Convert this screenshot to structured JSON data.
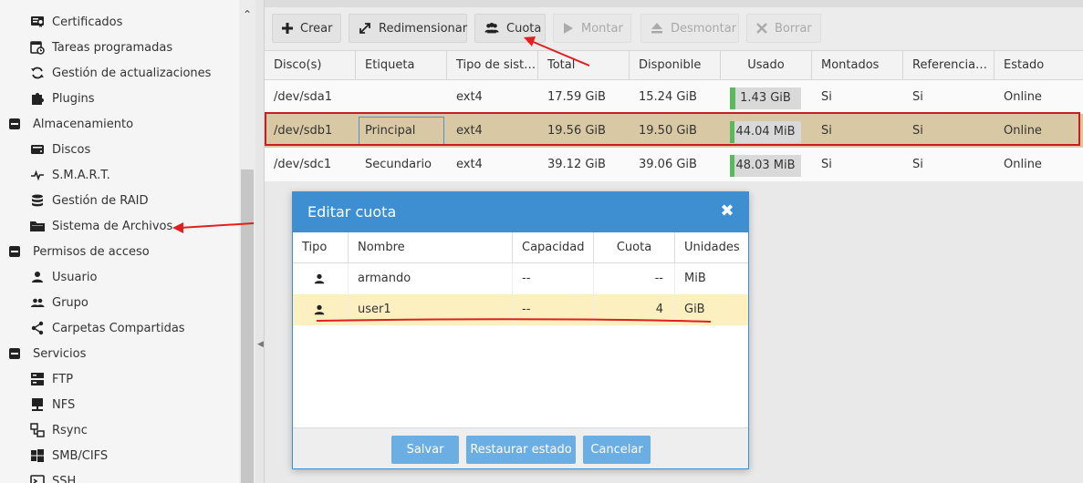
{
  "sidebar": {
    "items": [
      {
        "label": "Certificados",
        "icon": "certificate-icon",
        "level": 1
      },
      {
        "label": "Tareas programadas",
        "icon": "calendar-clock-icon",
        "level": 1
      },
      {
        "label": "Gestión de actualizaciones",
        "icon": "refresh-icon",
        "level": 1
      },
      {
        "label": "Plugins",
        "icon": "puzzle-icon",
        "level": 1
      },
      {
        "label": "Almacenamiento",
        "icon": "collapse-icon",
        "level": 0
      },
      {
        "label": "Discos",
        "icon": "disk-icon",
        "level": 1
      },
      {
        "label": "S.M.A.R.T.",
        "icon": "heartbeat-icon",
        "level": 1
      },
      {
        "label": "Gestión de RAID",
        "icon": "database-icon",
        "level": 1
      },
      {
        "label": "Sistema de Archivos",
        "icon": "folder-icon",
        "level": 1
      },
      {
        "label": "Permisos de acceso",
        "icon": "collapse-icon",
        "level": 0
      },
      {
        "label": "Usuario",
        "icon": "user-icon",
        "level": 1
      },
      {
        "label": "Grupo",
        "icon": "group-icon",
        "level": 1
      },
      {
        "label": "Carpetas Compartidas",
        "icon": "share-icon",
        "level": 1
      },
      {
        "label": "Servicios",
        "icon": "collapse-icon",
        "level": 0
      },
      {
        "label": "FTP",
        "icon": "server-icon",
        "level": 1
      },
      {
        "label": "NFS",
        "icon": "monitor-icon",
        "level": 1
      },
      {
        "label": "Rsync",
        "icon": "network-icon",
        "level": 1
      },
      {
        "label": "SMB/CIFS",
        "icon": "windows-icon",
        "level": 1
      },
      {
        "label": "SSH",
        "icon": "terminal-icon",
        "level": 1
      }
    ]
  },
  "toolbar": {
    "crear": "Crear",
    "redimensionar": "Redimensionar",
    "cuota": "Cuota",
    "montar": "Montar",
    "desmontar": "Desmontar",
    "borrar": "Borrar"
  },
  "grid": {
    "headers": [
      "Disco(s)",
      "Etiqueta",
      "Tipo de sist…",
      "Total",
      "Disponible",
      "Usado",
      "Montados",
      "Referencia…",
      "Estado"
    ],
    "rows": [
      {
        "disk": "/dev/sda1",
        "label": "",
        "type": "ext4",
        "total": "17.59 GiB",
        "available": "15.24 GiB",
        "used": "1.43 GiB",
        "used_fraction": 0.08,
        "mounted": "Si",
        "referenced": "Si",
        "status": "Online",
        "selected": false
      },
      {
        "disk": "/dev/sdb1",
        "label": "Principal",
        "type": "ext4",
        "total": "19.56 GiB",
        "available": "19.50 GiB",
        "used": "44.04 MiB",
        "used_fraction": 0.01,
        "mounted": "Si",
        "referenced": "Si",
        "status": "Online",
        "selected": true
      },
      {
        "disk": "/dev/sdc1",
        "label": "Secundario",
        "type": "ext4",
        "total": "39.12 GiB",
        "available": "39.06 GiB",
        "used": "48.03 MiB",
        "used_fraction": 0.01,
        "mounted": "Si",
        "referenced": "Si",
        "status": "Online",
        "selected": false
      }
    ]
  },
  "dialog": {
    "title": "Editar cuota",
    "headers": [
      "Tipo",
      "Nombre",
      "Capacidad",
      "Cuota",
      "Unidades"
    ],
    "rows": [
      {
        "type_icon": "user-icon",
        "name": "armando",
        "capacity": "--",
        "quota": "--",
        "units": "MiB",
        "selected": false
      },
      {
        "type_icon": "user-icon",
        "name": "user1",
        "capacity": "--",
        "quota": "4",
        "units": "GiB",
        "selected": true
      }
    ],
    "buttons": {
      "save": "Salvar",
      "reset": "Restaurar estado",
      "cancel": "Cancelar"
    }
  },
  "colors": {
    "dialog_header": "#3d8fd1",
    "selected_row": "#d8c9a4",
    "dialog_selected_row": "#fcefc0",
    "annotation": "#e02020",
    "usage_fill": "#5cb85c",
    "button": "#6aaee4"
  }
}
